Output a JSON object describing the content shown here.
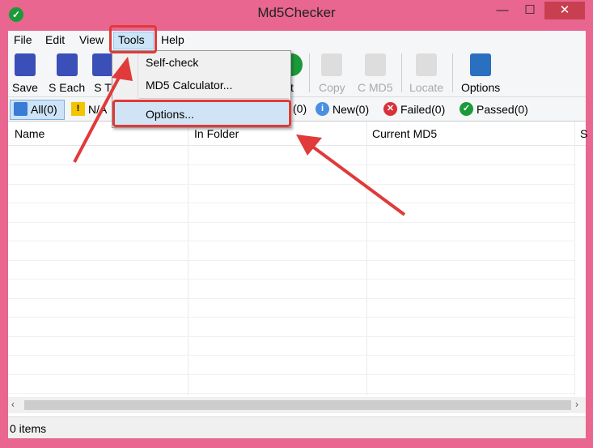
{
  "window": {
    "title": "Md5Checker",
    "minimize": "—",
    "maximize": "☐",
    "close": "✕"
  },
  "menu": [
    "File",
    "Edit",
    "View",
    "Tools",
    "Help"
  ],
  "dropdown": {
    "items": [
      "Self-check",
      "MD5 Calculator...",
      "Options..."
    ],
    "highlighted": "Options..."
  },
  "toolbar": [
    {
      "label": "Save",
      "color": "#3b4fb8"
    },
    {
      "label": "S Each",
      "color": "#3b4fb8"
    },
    {
      "label": "S T",
      "color": "#3b4fb8"
    },
    {
      "label": "t",
      "color": "#1b9a3a"
    },
    {
      "label": "Copy",
      "disabled": true
    },
    {
      "label": "C MD5",
      "disabled": true
    },
    {
      "label": "Locate",
      "disabled": true
    },
    {
      "label": "Options",
      "color": "#2a6fc0"
    }
  ],
  "filters": [
    {
      "label": "All(0)",
      "selected": true
    },
    {
      "label": "N/A"
    },
    {
      "label": "(0)"
    },
    {
      "label": "New(0)"
    },
    {
      "label": "Failed(0)"
    },
    {
      "label": "Passed(0)"
    }
  ],
  "columns": [
    "Name",
    "In Folder",
    "Current MD5",
    "S"
  ],
  "status": {
    "text": "0 items"
  },
  "colors": {
    "highlight": "#e03a3a",
    "border": "#e8668f"
  }
}
